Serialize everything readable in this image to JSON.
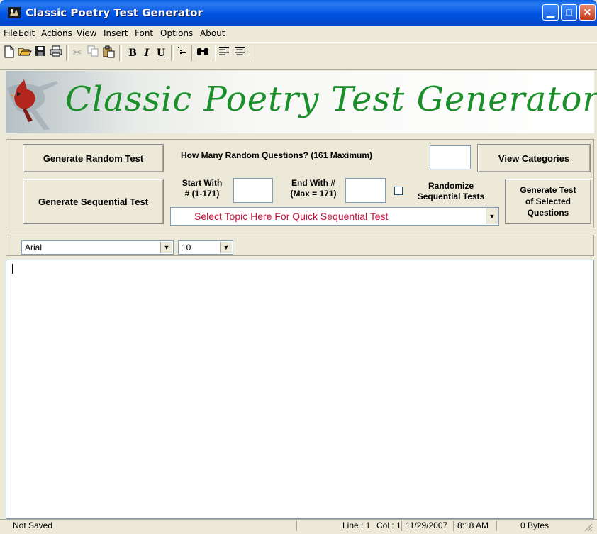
{
  "window": {
    "title": "Classic Poetry Test Generator",
    "min_glyph": "▁",
    "max_glyph": "□",
    "close_glyph": "✕"
  },
  "menu": [
    "File",
    "Edit",
    "Actions",
    "View",
    "Insert",
    "Font",
    "Options",
    "About"
  ],
  "menu_underline": [
    "F",
    "E",
    "A",
    "V",
    "I",
    "F",
    "O",
    "A"
  ],
  "toolbar": {
    "icons": [
      "new-document-icon",
      "open-folder-icon",
      "save-icon",
      "print-icon",
      "cut-icon",
      "copy-icon",
      "paste-icon",
      "bold-icon",
      "italic-icon",
      "underline-icon",
      "bullets-icon",
      "find-icon",
      "align-left-icon",
      "align-center-icon"
    ],
    "bold_glyph": "B",
    "italic_glyph": "I",
    "underline_glyph": "U"
  },
  "banner": {
    "title": "Classic Poetry Test Generator",
    "title_color": "#1b8f2a"
  },
  "panel": {
    "generate_random_label": "Generate Random Test",
    "how_many_label": "How Many Random Questions? (161 Maximum)",
    "how_many_value": "",
    "view_categories_label": "View Categories",
    "generate_sequential_label": "Generate Sequential Test",
    "start_with_label_1": "Start With",
    "start_with_label_2": "# (1-171)",
    "start_value": "",
    "end_with_label_1": "End With #",
    "end_with_label_2": "(Max = 171)",
    "end_value": "",
    "randomize_label_1": "Randomize",
    "randomize_label_2": "Sequential Tests",
    "randomize_checked": false,
    "generate_selected_label_1": "Generate Test",
    "generate_selected_label_2": "of Selected",
    "generate_selected_label_3": "Questions",
    "topic_select_value": "Select Topic Here For Quick Sequential Test",
    "topic_select_color": "#c0143c"
  },
  "fontbar": {
    "font_name": "Arial",
    "font_size": "10"
  },
  "editor": {
    "content": ""
  },
  "status": {
    "saved": "Not Saved",
    "line": "Line : 1",
    "col": "Col : 1",
    "date": "11/29/2007",
    "time": "8:18 AM",
    "size": "0 Bytes"
  }
}
